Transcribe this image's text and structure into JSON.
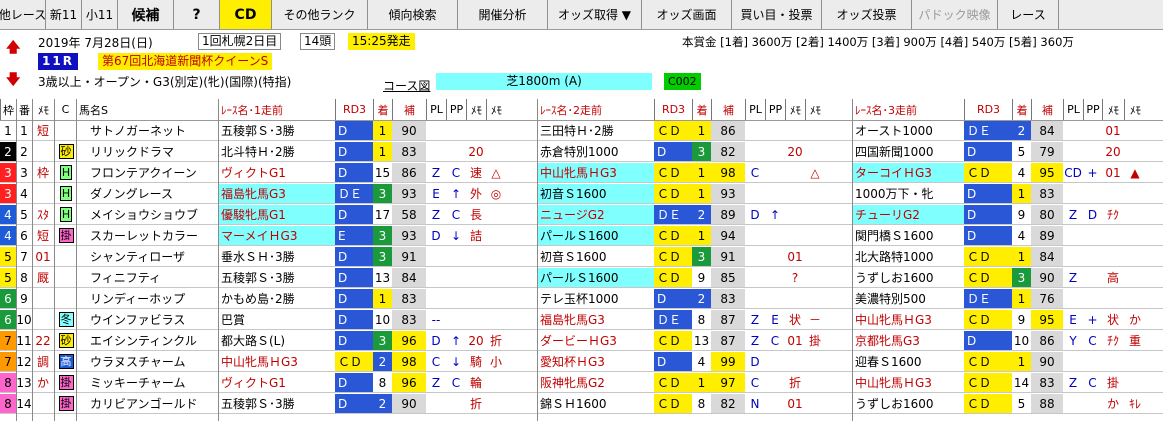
{
  "toolbar": {
    "buttons": [
      {
        "label": "他レース",
        "w": 46,
        "style": "normal"
      },
      {
        "label": "新11",
        "w": 36,
        "style": "normal"
      },
      {
        "label": "小11",
        "w": 36,
        "style": "normal"
      },
      {
        "label": "候補",
        "w": 56,
        "style": "bold"
      },
      {
        "label": "?",
        "w": 46,
        "style": "bold"
      },
      {
        "label": "CD",
        "w": 52,
        "style": "hl"
      },
      {
        "label": "その他ランク",
        "w": 96,
        "style": "normal"
      },
      {
        "label": "傾向検索",
        "w": 90,
        "style": "normal"
      },
      {
        "label": "開催分析",
        "w": 90,
        "style": "normal"
      },
      {
        "label": "オッズ取得 ▼",
        "w": 94,
        "style": "normal"
      },
      {
        "label": "オッズ画面",
        "w": 90,
        "style": "normal"
      },
      {
        "label": "買い目・投票",
        "w": 90,
        "style": "normal"
      },
      {
        "label": "オッズ投票",
        "w": 90,
        "style": "normal"
      },
      {
        "label": "パドック映像",
        "w": 86,
        "style": "gray"
      },
      {
        "label": "レース",
        "w": 61,
        "style": "normal"
      }
    ]
  },
  "race": {
    "date": "2019年 7月28日(日)",
    "meeting": "1回札幌2日目",
    "heads": "14頭",
    "start": "15:25発走",
    "prize": "本賞金 [1着] 3600万 [2着] 1400万 [3着] 900万 [4着] 540万 [5着] 360万",
    "race_no": "11R",
    "name": "第67回北海道新聞杯クイーンS",
    "conditions": "3歳以上・オープン・G3(別定)(牝)(国際)(特指)",
    "course_label": "コース図",
    "course": "芝1800m (A)",
    "code": "C002"
  },
  "header": {
    "waku": "枠",
    "ban": "番",
    "memo": "ﾒﾓ",
    "c": "C",
    "name": "馬名S",
    "run1": "ﾚｰｽ名･1走前",
    "run2": "ﾚｰｽ名･2走前",
    "run3": "ﾚｰｽ名･3走前",
    "rd": "RD3",
    "chaku": "着",
    "ho": "補",
    "pl": "PL",
    "pp": "PP",
    "m1": "ﾒﾓ",
    "m2": "ﾒﾓ"
  },
  "horses": [
    {
      "waku": "1",
      "ban": "1",
      "memo": "短",
      "c": "",
      "name": "サトノガーネット",
      "r1": {
        "race": "五稜郭Ｓ･3勝",
        "rd": "D",
        "chaku": "1",
        "ho": "90",
        "pl": "",
        "pp": "",
        "m1": "",
        "m2": ""
      },
      "r2": {
        "race": "三田特Ｈ･2勝",
        "rd": "ＣＤ",
        "chaku": "1",
        "ho": "86",
        "pl": "",
        "pp": "",
        "m1": "",
        "m2": ""
      },
      "r3": {
        "race": "オースト1000",
        "rd": "ＤＥ",
        "chaku": "2",
        "ho": "84",
        "pl": "",
        "pp": "",
        "m1": "01",
        "m2": ""
      }
    },
    {
      "waku": "2",
      "ban": "2",
      "memo": "",
      "c": "砂",
      "name": "リリックドラマ",
      "r1": {
        "race": "北斗特Ｈ･2勝",
        "rd": "D",
        "chaku": "1",
        "ho": "83",
        "pl": "",
        "pp": "",
        "m1": "20",
        "m2": ""
      },
      "r2": {
        "race": "赤倉特別1000",
        "rd": "D",
        "chaku": "3",
        "ho": "82",
        "pl": "",
        "pp": "",
        "m1": "20",
        "m2": ""
      },
      "r3": {
        "race": "四国新聞1000",
        "rd": "D",
        "chaku": "5",
        "ho": "79",
        "pl": "",
        "pp": "",
        "m1": "20",
        "m2": ""
      }
    },
    {
      "waku": "3",
      "ban": "3",
      "memo": "枠",
      "c": "H",
      "name": "フロンテアクイーン",
      "r1": {
        "race": "ヴィクトG1",
        "rd": "D",
        "chaku": "15",
        "ho": "86",
        "pl": "Z",
        "pp": "C",
        "m1": "速",
        "m2": "△"
      },
      "r2": {
        "race": "中山牝馬ＨG3",
        "rd": "ＣＤ",
        "chaku": "1",
        "ho": "98",
        "pl": "C",
        "pp": "",
        "m1": "",
        "m2": "△"
      },
      "r3": {
        "race": "ターコイＨG3",
        "rd": "ＣＤ",
        "chaku": "4",
        "ho": "95",
        "pl": "CD",
        "pp": "+",
        "m1": "01",
        "m2": "▲"
      }
    },
    {
      "waku": "3",
      "ban": "4",
      "memo": "",
      "c": "H",
      "name": "ダノングレース",
      "r1": {
        "race": "福島牝馬G3",
        "rd": "ＤＥ",
        "chaku": "3",
        "ho": "93",
        "pl": "E",
        "pp": "↑",
        "m1": "外",
        "m2": "◎"
      },
      "r2": {
        "race": "初音Ｓ1600",
        "rd": "ＣＤ",
        "chaku": "1",
        "ho": "93",
        "pl": "",
        "pp": "",
        "m1": "",
        "m2": ""
      },
      "r3": {
        "race": "1000万下・牝",
        "rd": "D",
        "chaku": "1",
        "ho": "83",
        "pl": "",
        "pp": "",
        "m1": "",
        "m2": ""
      }
    },
    {
      "waku": "4",
      "ban": "5",
      "memo": "ｽﾀ",
      "c": "H",
      "name": "メイショウショウブ",
      "r1": {
        "race": "優駿牝馬G1",
        "rd": "D",
        "chaku": "17",
        "ho": "58",
        "pl": "Z",
        "pp": "C",
        "m1": "長",
        "m2": ""
      },
      "r2": {
        "race": "ニュージG2",
        "rd": "ＤＥ",
        "chaku": "2",
        "ho": "89",
        "pl": "D",
        "pp": "↑",
        "m1": "",
        "m2": ""
      },
      "r3": {
        "race": "チューリG2",
        "rd": "D",
        "chaku": "9",
        "ho": "80",
        "pl": "Z",
        "pp": "D",
        "m1": "ﾁｸ",
        "m2": ""
      }
    },
    {
      "waku": "4",
      "ban": "6",
      "memo": "短",
      "c": "掛",
      "name": "スカーレットカラー",
      "r1": {
        "race": "マーメイＨG3",
        "rd": "E",
        "chaku": "3",
        "ho": "93",
        "pl": "D",
        "pp": "↓",
        "m1": "詰",
        "m2": ""
      },
      "r2": {
        "race": "パールＳ1600",
        "rd": "ＣＤ",
        "chaku": "1",
        "ho": "94",
        "pl": "",
        "pp": "",
        "m1": "",
        "m2": ""
      },
      "r3": {
        "race": "関門橋Ｓ1600",
        "rd": "D",
        "chaku": "4",
        "ho": "89",
        "pl": "",
        "pp": "",
        "m1": "",
        "m2": ""
      }
    },
    {
      "waku": "5",
      "ban": "7",
      "memo": "01",
      "c": "",
      "name": "シャンティローザ",
      "r1": {
        "race": "垂水ＳＨ･3勝",
        "rd": "D",
        "chaku": "3",
        "ho": "91",
        "pl": "",
        "pp": "",
        "m1": "",
        "m2": ""
      },
      "r2": {
        "race": "初音Ｓ1600",
        "rd": "ＣＤ",
        "chaku": "3",
        "ho": "91",
        "pl": "",
        "pp": "",
        "m1": "01",
        "m2": ""
      },
      "r3": {
        "race": "北大路特1000",
        "rd": "ＣＤ",
        "chaku": "1",
        "ho": "84",
        "pl": "",
        "pp": "",
        "m1": "",
        "m2": ""
      }
    },
    {
      "waku": "5",
      "ban": "8",
      "memo": "厩",
      "c": "",
      "name": "フィニフティ",
      "r1": {
        "race": "五稜郭Ｓ･3勝",
        "rd": "D",
        "chaku": "13",
        "ho": "84",
        "pl": "",
        "pp": "",
        "m1": "",
        "m2": ""
      },
      "r2": {
        "race": "パールＳ1600",
        "rd": "ＣＤ",
        "chaku": "9",
        "ho": "85",
        "pl": "",
        "pp": "",
        "m1": "?",
        "m2": ""
      },
      "r3": {
        "race": "うずしお1600",
        "rd": "ＣＤ",
        "chaku": "3",
        "ho": "90",
        "pl": "Z",
        "pp": "",
        "m1": "高",
        "m2": ""
      }
    },
    {
      "waku": "6",
      "ban": "9",
      "memo": "",
      "c": "",
      "name": "リンディーホップ",
      "r1": {
        "race": "かもめ島･2勝",
        "rd": "D",
        "chaku": "1",
        "ho": "83",
        "pl": "",
        "pp": "",
        "m1": "",
        "m2": ""
      },
      "r2": {
        "race": "テレ玉杯1000",
        "rd": "D",
        "chaku": "2",
        "ho": "83",
        "pl": "",
        "pp": "",
        "m1": "",
        "m2": ""
      },
      "r3": {
        "race": "美濃特別500",
        "rd": "ＤＥ",
        "chaku": "1",
        "ho": "76",
        "pl": "",
        "pp": "",
        "m1": "",
        "m2": ""
      }
    },
    {
      "waku": "6",
      "ban": "10",
      "memo": "",
      "c": "冬",
      "name": "ウインファビラス",
      "r1": {
        "race": "巴賞",
        "rd": "D",
        "chaku": "10",
        "ho": "83",
        "pl": "--",
        "pp": "",
        "m1": "",
        "m2": ""
      },
      "r2": {
        "race": "福島牝馬G3",
        "rd": "ＤＥ",
        "chaku": "8",
        "ho": "87",
        "pl": "Z",
        "pp": "E",
        "m1": "状",
        "m2": "－"
      },
      "r3": {
        "race": "中山牝馬ＨG3",
        "rd": "ＣＤ",
        "chaku": "9",
        "ho": "95",
        "pl": "E",
        "pp": "+",
        "m1": "状",
        "m2": "か"
      }
    },
    {
      "waku": "7",
      "ban": "11",
      "memo": "22",
      "c": "砂",
      "name": "エイシンティンクル",
      "r1": {
        "race": "都大路Ｓ(L)",
        "rd": "D",
        "chaku": "3",
        "ho": "96",
        "pl": "D",
        "pp": "↑",
        "m1": "20",
        "m2": "折"
      },
      "r2": {
        "race": "ダービーＨG3",
        "rd": "ＣＤ",
        "chaku": "13",
        "ho": "87",
        "pl": "Z",
        "pp": "C",
        "m1": "01",
        "m2": "掛"
      },
      "r3": {
        "race": "京都牝馬G3",
        "rd": "D",
        "chaku": "10",
        "ho": "86",
        "pl": "Y",
        "pp": "C",
        "m1": "ﾁｸ",
        "m2": "重"
      }
    },
    {
      "waku": "7",
      "ban": "12",
      "memo": "調",
      "c": "高",
      "name": "ウラヌスチャーム",
      "r1": {
        "race": "中山牝馬ＨG3",
        "rd": "ＣＤ",
        "chaku": "2",
        "ho": "98",
        "pl": "C",
        "pp": "↓",
        "m1": "騎",
        "m2": "小"
      },
      "r2": {
        "race": "愛知杯ＨG3",
        "rd": "D",
        "chaku": "4",
        "ho": "99",
        "pl": "D",
        "pp": "",
        "m1": "",
        "m2": ""
      },
      "r3": {
        "race": "迎春Ｓ1600",
        "rd": "ＣＤ",
        "chaku": "1",
        "ho": "90",
        "pl": "",
        "pp": "",
        "m1": "",
        "m2": ""
      }
    },
    {
      "waku": "8",
      "ban": "13",
      "memo": "か",
      "c": "掛",
      "name": "ミッキーチャーム",
      "r1": {
        "race": "ヴィクトG1",
        "rd": "D",
        "chaku": "8",
        "ho": "96",
        "pl": "Z",
        "pp": "C",
        "m1": "輪",
        "m2": ""
      },
      "r2": {
        "race": "阪神牝馬G2",
        "rd": "ＣＤ",
        "chaku": "1",
        "ho": "97",
        "pl": "C",
        "pp": "",
        "m1": "折",
        "m2": ""
      },
      "r3": {
        "race": "中山牝馬ＨG3",
        "rd": "ＣＤ",
        "chaku": "14",
        "ho": "83",
        "pl": "Z",
        "pp": "C",
        "m1": "掛",
        "m2": ""
      }
    },
    {
      "waku": "8",
      "ban": "14",
      "memo": "",
      "c": "掛",
      "name": "カリビアンゴールド",
      "r1": {
        "race": "五稜郭Ｓ･3勝",
        "rd": "D",
        "chaku": "2",
        "ho": "90",
        "pl": "",
        "pp": "",
        "m1": "折",
        "m2": ""
      },
      "r2": {
        "race": "錦ＳＨ1600",
        "rd": "ＣＤ",
        "chaku": "8",
        "ho": "82",
        "pl": "N",
        "pp": "",
        "m1": "01",
        "m2": ""
      },
      "r3": {
        "race": "うずしお1600",
        "rd": "ＣＤ",
        "chaku": "5",
        "ho": "88",
        "pl": "",
        "pp": "",
        "m1": "か",
        "m2": "ｷﾚ"
      }
    }
  ]
}
